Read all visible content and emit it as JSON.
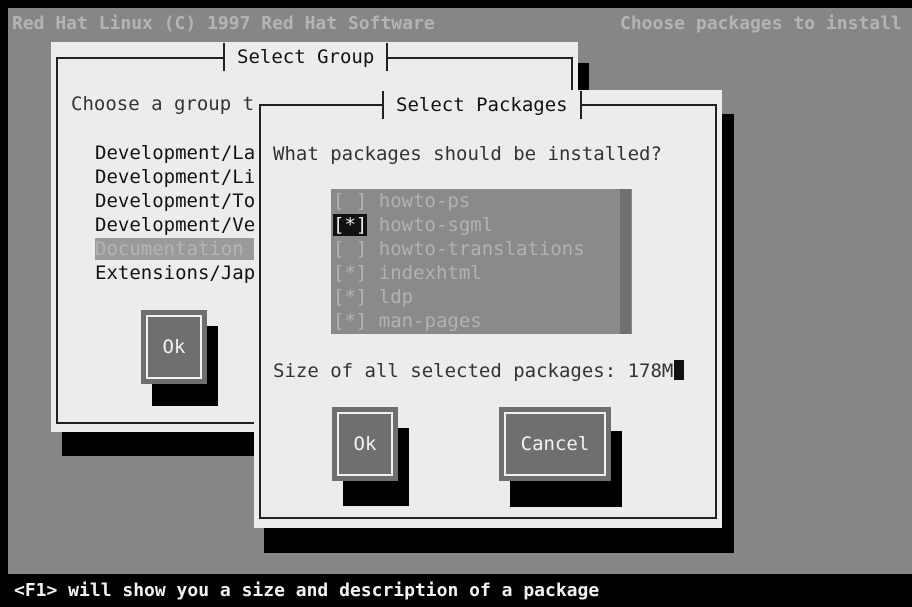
{
  "topbar": {
    "left_text": "Red Hat Linux (C) 1997 Red Hat Software",
    "right_text": "Choose packages to install"
  },
  "group_dialog": {
    "title": "Select Group",
    "prompt": "Choose a group t",
    "groups": [
      {
        "label": "Development/La",
        "selected": false
      },
      {
        "label": "Development/Li",
        "selected": false
      },
      {
        "label": "Development/To",
        "selected": false
      },
      {
        "label": "Development/Ve",
        "selected": false
      },
      {
        "label": "Documentation",
        "selected": true
      },
      {
        "label": "Extensions/Jap",
        "selected": false
      }
    ],
    "ok_label": "Ok"
  },
  "packages_dialog": {
    "title": "Select Packages",
    "prompt": "What packages should be installed?",
    "packages": [
      {
        "checkbox": "[ ]",
        "name": "howto-ps",
        "checked": false
      },
      {
        "checkbox": "[*]",
        "name": "howto-sgml",
        "checked": true
      },
      {
        "checkbox": "[ ]",
        "name": "howto-translations",
        "checked": false
      },
      {
        "checkbox": "[*]",
        "name": "indexhtml",
        "checked": true
      },
      {
        "checkbox": "[*]",
        "name": "ldp",
        "checked": true
      },
      {
        "checkbox": "[*]",
        "name": "man-pages",
        "checked": true
      }
    ],
    "size_label": "Size of all selected packages: 178M",
    "ok_label": "Ok",
    "cancel_label": "Cancel"
  },
  "bottombar": {
    "help_text": "<F1> will show you a size and description of a package"
  }
}
